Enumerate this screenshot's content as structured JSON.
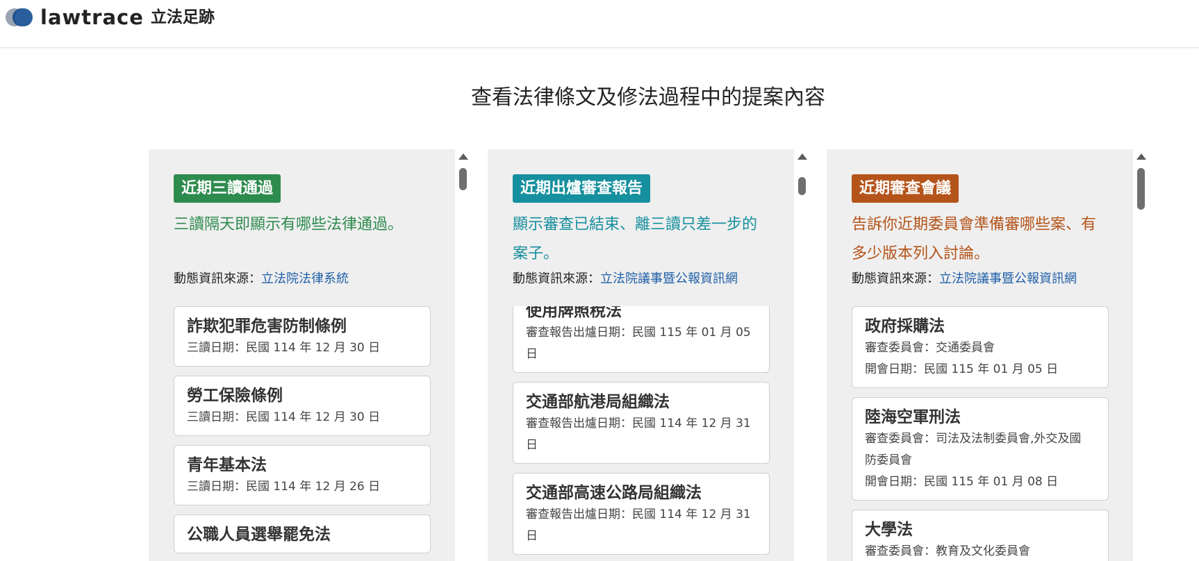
{
  "header": {
    "logo_text": "lawtrace",
    "logo_cn": "立法足跡"
  },
  "page": {
    "title": "查看法律條文及修法過程中的提案內容"
  },
  "columns": [
    {
      "tag": "近期三讀通過",
      "tag_color": "#2e8b4e",
      "desc": "三讀隔天即顯示有哪些法律通過。",
      "desc_color": "#2e8b4e",
      "source_label": "動態資訊來源：",
      "source_link": "立法院法律系統",
      "cards": [
        {
          "title": "詐欺犯罪危害防制條例",
          "lines": [
            "三讀日期：民國 114 年 12 月 30 日"
          ]
        },
        {
          "title": "勞工保險條例",
          "lines": [
            "三讀日期：民國 114 年 12 月 30 日"
          ]
        },
        {
          "title": "青年基本法",
          "lines": [
            "三讀日期：民國 114 年 12 月 26 日"
          ]
        },
        {
          "title": "公職人員選舉罷免法",
          "lines": []
        }
      ]
    },
    {
      "tag": "近期出爐審查報告",
      "tag_color": "#168f9e",
      "desc": "顯示審查已結束、離三讀只差一步的案子。",
      "desc_color": "#168f9e",
      "source_label": "動態資訊來源：",
      "source_link": "立法院議事暨公報資訊網",
      "cards": [
        {
          "title": "使用牌照稅法",
          "lines": [
            "審查報告出爐日期：民國 115 年 01 月 05",
            "日"
          ]
        },
        {
          "title": "交通部航港局組織法",
          "lines": [
            "審查報告出爐日期：民國 114 年 12 月 31",
            "日"
          ]
        },
        {
          "title": "交通部高速公路局組織法",
          "lines": [
            "審查報告出爐日期：民國 114 年 12 月 31",
            "日"
          ]
        }
      ]
    },
    {
      "tag": "近期審查會議",
      "tag_color": "#b5541a",
      "desc": "告訴你近期委員會準備審哪些案、有多少版本列入討論。",
      "desc_color": "#b5541a",
      "source_label": "動態資訊來源：",
      "source_link": "立法院議事暨公報資訊網",
      "cards": [
        {
          "title": "政府採購法",
          "lines": [
            "審查委員會：交通委員會",
            "開會日期：民國 115 年 01 月 05 日"
          ]
        },
        {
          "title": "陸海空軍刑法",
          "lines": [
            "審查委員會：司法及法制委員會,外交及國",
            "防委員會",
            "開會日期：民國 115 年 01 月 08 日"
          ]
        },
        {
          "title": "大學法",
          "lines": [
            "審查委員會：教育及文化委員會"
          ]
        }
      ]
    }
  ]
}
